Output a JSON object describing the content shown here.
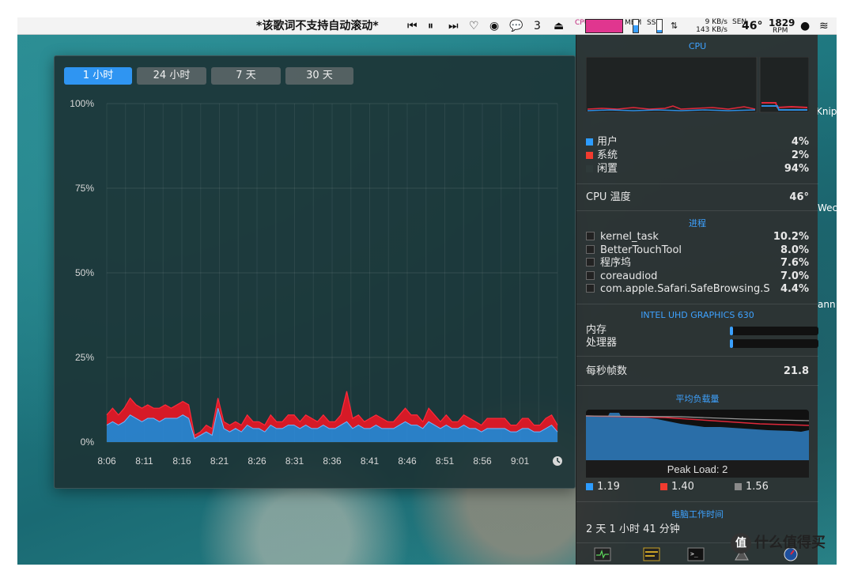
{
  "menubar": {
    "lyric": "*该歌词不支持自动滚动*",
    "wechat_count": "3",
    "cpu_label": "CPU",
    "mem_label": "MEM",
    "ssd_label": "SSD",
    "net_up": "9 KB/s",
    "net_down": "143 KB/s",
    "sen_label": "SEN",
    "temp": "46°",
    "fan": "1829",
    "rpm_label": "RPM",
    "mem_fill_pct": 55,
    "ssd_fill_pct": 20
  },
  "chart_window": {
    "tabs": [
      "1 小时",
      "24 小时",
      "7 天",
      "30 天"
    ],
    "active_tab": 0
  },
  "chart_data": {
    "type": "area",
    "x_ticks": [
      "8:06",
      "8:11",
      "8:16",
      "8:21",
      "8:26",
      "8:31",
      "8:36",
      "8:41",
      "8:46",
      "8:51",
      "8:56",
      "9:01"
    ],
    "y_ticks": [
      "100%",
      "75%",
      "50%",
      "25%",
      "0%"
    ],
    "ylim": [
      0,
      100
    ],
    "grid": true,
    "series": [
      {
        "name": "用户",
        "color": "#2d8de0",
        "values": [
          5,
          6,
          5,
          6,
          8,
          7,
          6,
          7,
          7,
          6,
          7,
          7,
          7,
          8,
          7,
          1,
          2,
          3,
          2,
          10,
          4,
          3,
          4,
          3,
          5,
          4,
          4,
          3,
          5,
          4,
          4,
          5,
          5,
          4,
          5,
          4,
          4,
          5,
          4,
          4,
          5,
          6,
          4,
          5,
          4,
          4,
          5,
          4,
          4,
          4,
          5,
          6,
          5,
          5,
          4,
          6,
          5,
          4,
          5,
          4,
          4,
          5,
          4,
          4,
          3,
          4,
          4,
          4,
          4,
          3,
          3,
          4,
          4,
          3,
          3,
          4,
          5,
          3
        ]
      },
      {
        "name": "系统",
        "color": "#e01826",
        "values": [
          3,
          4,
          3,
          4,
          5,
          4,
          4,
          4,
          3,
          4,
          4,
          3,
          4,
          4,
          4,
          1,
          1,
          2,
          2,
          3,
          2,
          2,
          2,
          2,
          3,
          2,
          2,
          2,
          3,
          2,
          2,
          3,
          3,
          2,
          3,
          3,
          2,
          3,
          2,
          2,
          3,
          9,
          3,
          3,
          2,
          3,
          3,
          3,
          2,
          2,
          3,
          4,
          3,
          3,
          2,
          4,
          3,
          2,
          3,
          2,
          2,
          3,
          3,
          2,
          2,
          3,
          3,
          3,
          3,
          2,
          2,
          3,
          3,
          2,
          2,
          3,
          3,
          2
        ]
      }
    ],
    "clock_icon": "clock-icon"
  },
  "panel": {
    "cpu_title": "CPU",
    "cpu_legend": [
      {
        "label": "用户",
        "value": "4%",
        "color": "#2d9cff"
      },
      {
        "label": "系统",
        "value": "2%",
        "color": "#f23b2f"
      },
      {
        "label": "闲置",
        "value": "94%",
        "color": "#2f3a3a"
      }
    ],
    "cpu_temp_label": "CPU 温度",
    "cpu_temp_value": "46°",
    "proc_title": "进程",
    "processes": [
      {
        "name": "kernel_task",
        "value": "10.2%"
      },
      {
        "name": "BetterTouchTool",
        "value": "8.0%"
      },
      {
        "name": "程序坞",
        "value": "7.6%"
      },
      {
        "name": "coreaudiod",
        "value": "7.0%"
      },
      {
        "name": "com.apple.Safari.SafeBrowsing.S",
        "value": "4.4%"
      }
    ],
    "gpu_title": "INTEL UHD GRAPHICS 630",
    "gpu_rows": [
      {
        "label": "内存",
        "fill": 0.03
      },
      {
        "label": "处理器",
        "fill": 0.03
      }
    ],
    "fps_label": "每秒帧数",
    "fps_value": "21.8",
    "load_title": "平均负载量",
    "peak_load": "Peak Load: 2",
    "load_legend": [
      {
        "value": "1.19",
        "color": "#2d9cff"
      },
      {
        "value": "1.40",
        "color": "#f23b2f"
      },
      {
        "value": "1.56",
        "color": "#8a8a8a"
      }
    ],
    "uptime_title": "电脑工作时间",
    "uptime_value": "2 天 1 小时 41 分钟"
  },
  "desktop_labels": [
    "Knip",
    "Wec",
    "ann"
  ],
  "watermark": "什么值得买"
}
